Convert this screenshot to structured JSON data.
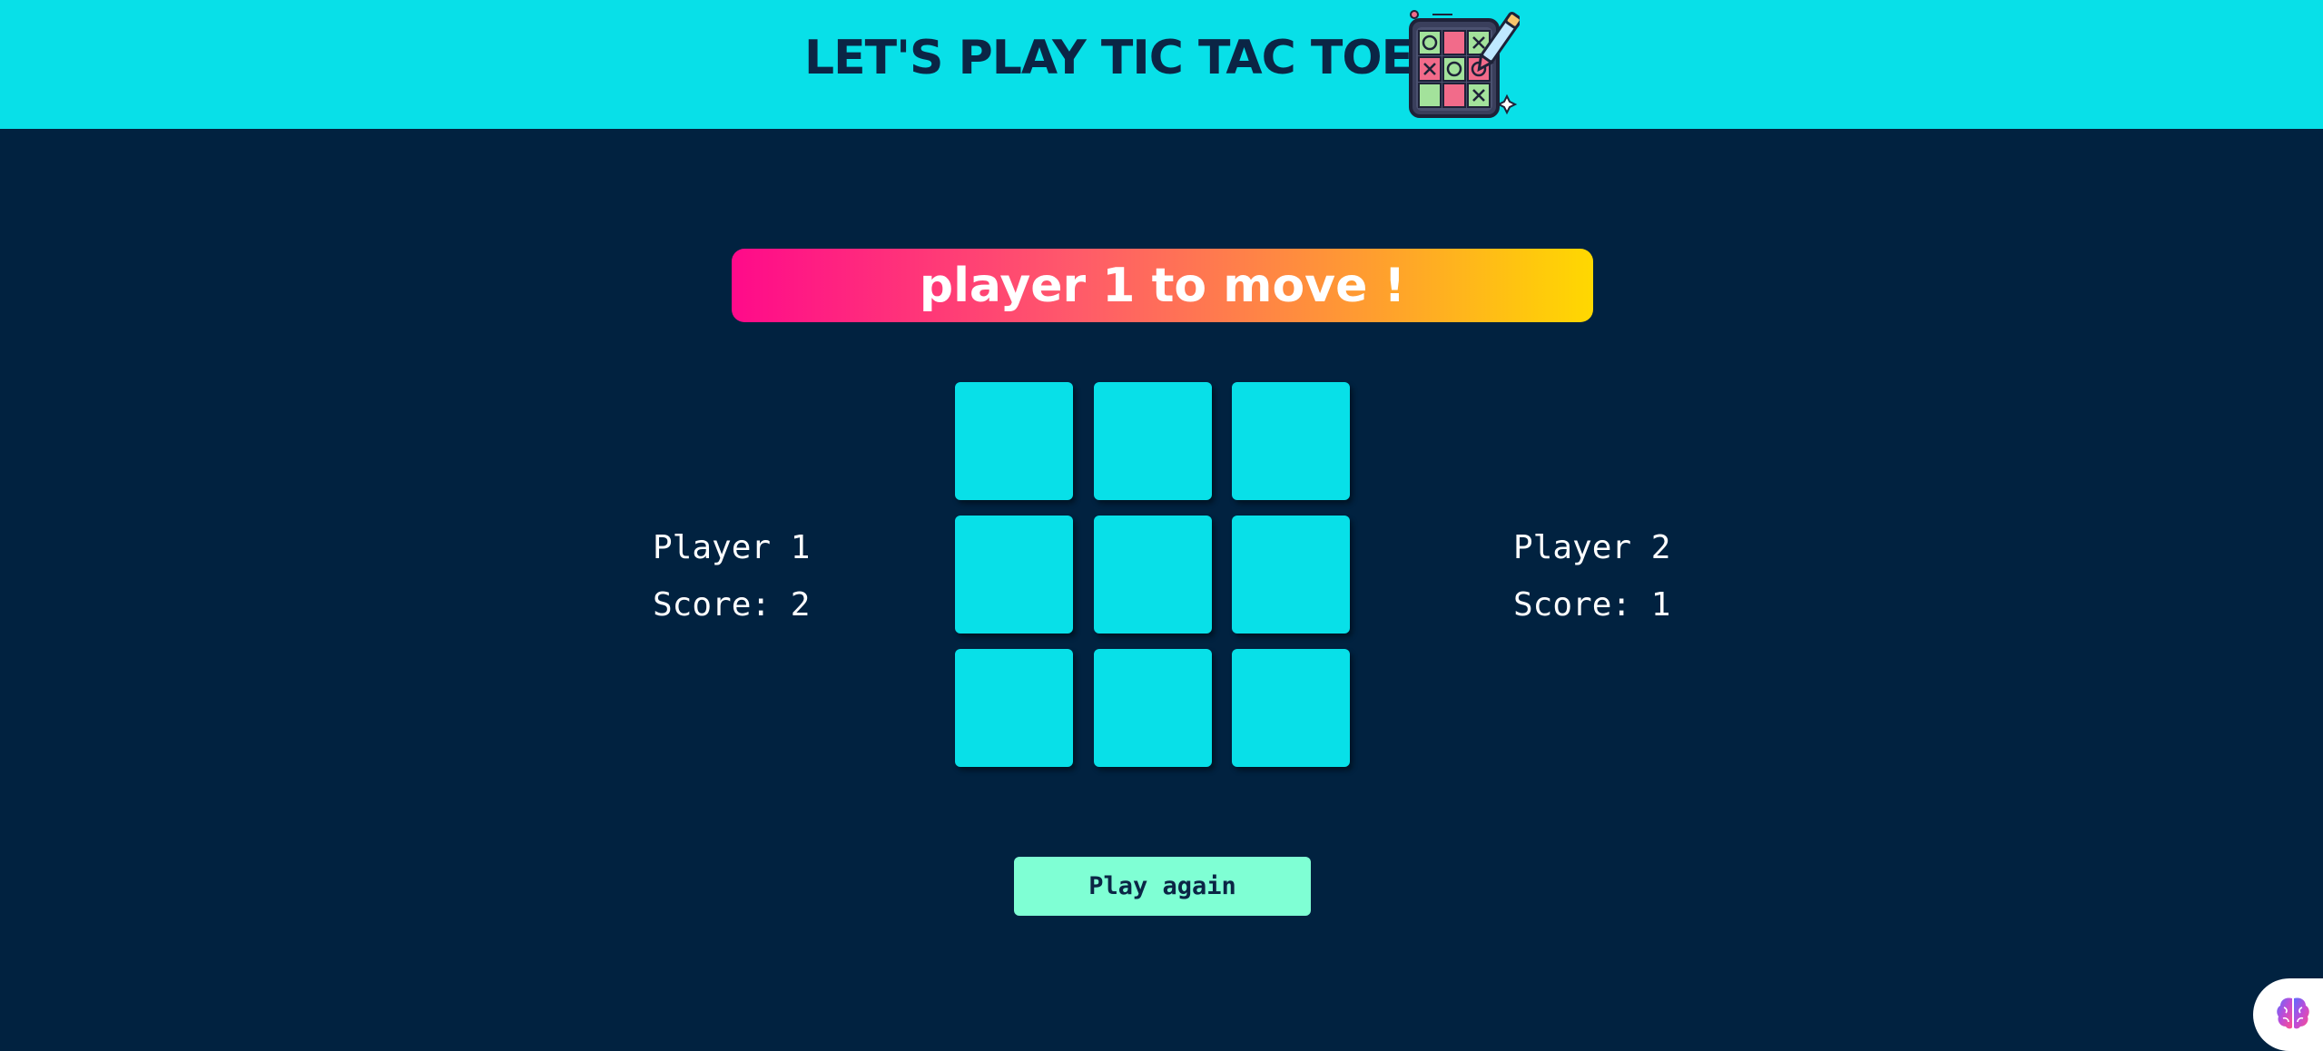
{
  "header": {
    "title": "LET'S PLAY TIC TAC TOE !",
    "logo_icon": "tic-tac-toe-board-with-pencil-icon"
  },
  "status": {
    "text": "player 1 to move !",
    "gradient_colors": [
      "#ff0a8a",
      "#ffd800"
    ]
  },
  "players": [
    {
      "name": "Player 1",
      "score_text": "Score: 2",
      "score": 2
    },
    {
      "name": "Player 2",
      "score_text": "Score: 1",
      "score": 1
    }
  ],
  "board": {
    "cells": [
      "",
      "",
      "",
      "",
      "",
      "",
      "",
      "",
      ""
    ]
  },
  "play_again_label": "Play again",
  "corner_widget_icon": "brain-icon",
  "colors": {
    "background": "#012240",
    "header": "#08e0e8",
    "cell": "#08e0e8",
    "button": "#7fffd4",
    "title_text": "#0b2545"
  }
}
